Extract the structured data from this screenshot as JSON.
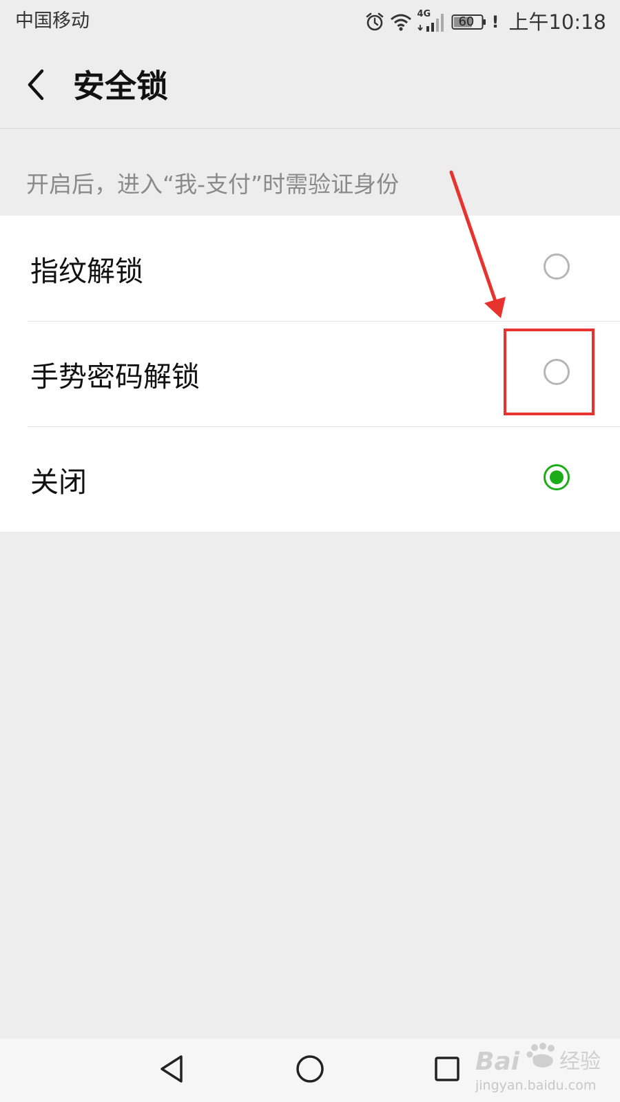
{
  "status_bar": {
    "carrier": "中国移动",
    "network_type": "4G",
    "battery": "60",
    "alert": "!",
    "time": "上午10:18",
    "icons": [
      "alarm-icon",
      "wifi-icon",
      "cellular-signal-icon",
      "battery-icon"
    ]
  },
  "header": {
    "title": "安全锁",
    "back_icon": "chevron-left-icon"
  },
  "hint": "开启后，进入“我-支付”时需验证身份",
  "options": [
    {
      "label": "指纹解锁",
      "checked": false
    },
    {
      "label": "手势密码解锁",
      "checked": false
    },
    {
      "label": "关闭",
      "checked": true
    }
  ],
  "colors": {
    "accent_green": "#1aad19",
    "annotation_red": "#e8322e",
    "background": "#ededed"
  },
  "nav_bar": {
    "icons": [
      "triangle-back-icon",
      "circle-home-icon",
      "square-recents-icon"
    ]
  },
  "watermark": {
    "brand": "Bai",
    "brand_suffix": "经验",
    "url": "jingyan.baidu.com"
  }
}
